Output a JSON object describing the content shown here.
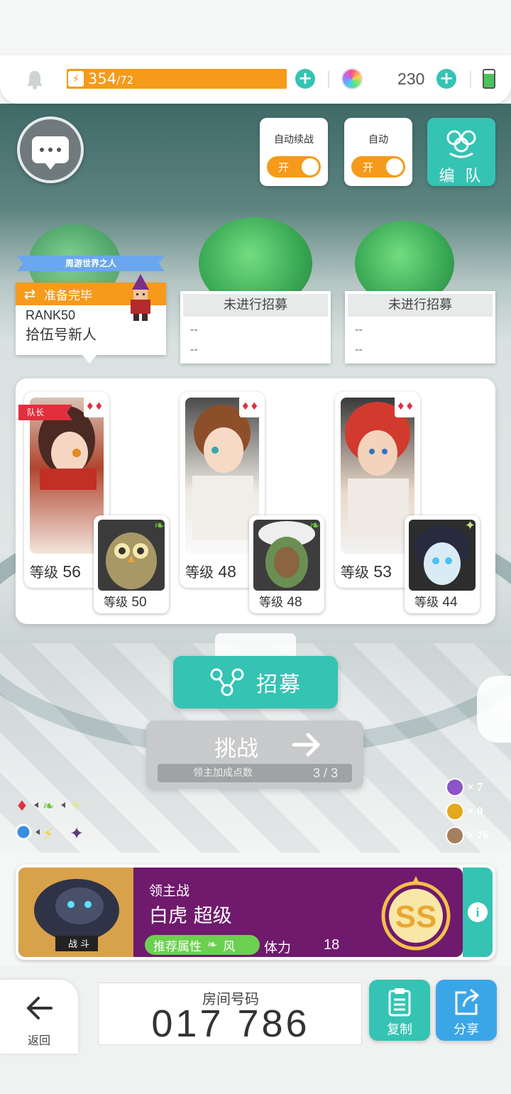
{
  "status": {
    "energy_value": "354",
    "energy_max": "/72",
    "gem_count": "230"
  },
  "toggles": [
    {
      "label": "自动续战",
      "state": "开"
    },
    {
      "label": "自动",
      "state": "开"
    }
  ],
  "team_button_label": "编 队",
  "player": {
    "title": "周游世界之人",
    "status": "准备完毕",
    "rank": "RANK50",
    "name": "拾伍号新人"
  },
  "slots": [
    {
      "header": "未进行招募",
      "line1": "--",
      "line2": "--"
    },
    {
      "header": "未进行招募",
      "line1": "--",
      "line2": "--"
    }
  ],
  "captain_label": "队长",
  "level_prefix": "等级",
  "heroes": [
    {
      "main_level": "56",
      "sub_level": "50",
      "sub_element": "wind"
    },
    {
      "main_level": "48",
      "sub_level": "48",
      "sub_element": "wind"
    },
    {
      "main_level": "53",
      "sub_level": "44",
      "sub_element": "light"
    }
  ],
  "recruit_label": "招募",
  "challenge": {
    "label": "挑战",
    "sub_label": "领主加成点数",
    "points": "3 / 3"
  },
  "tokens": [
    {
      "count": "× 7",
      "color": "#8b54c9"
    },
    {
      "count": "× 0",
      "color": "#e3a81c"
    },
    {
      "count": "× 76",
      "color": "#a67f5e"
    }
  ],
  "lord": {
    "tag": "领主战",
    "name": "白虎 超级",
    "attr_label": "推荐属性",
    "attr_value": "风",
    "stamina_label": "体力",
    "stamina_value": "18",
    "grade": "SS",
    "thumb_label": "战 斗"
  },
  "bottom": {
    "back_label": "返回",
    "room_label": "房间号码",
    "room_number": "017 786",
    "copy_label": "复制",
    "share_label": "分享"
  },
  "colors": {
    "accent": "#35c3b3",
    "orange": "#f59a1b",
    "lord_purple": "#6f1a6c",
    "share_blue": "#3aa6e8"
  }
}
